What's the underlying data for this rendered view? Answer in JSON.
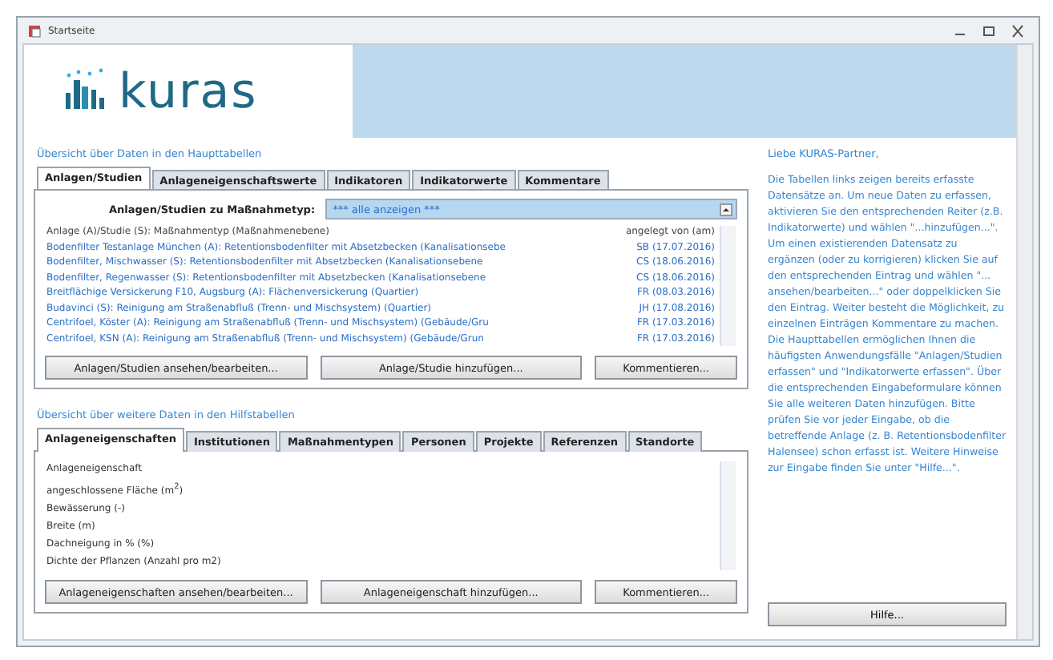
{
  "window": {
    "title": "Startseite"
  },
  "logo": {
    "text": "kuras"
  },
  "main": {
    "link": "Übersicht über Daten in den Haupttabellen",
    "tabs": [
      {
        "label": "Anlagen/Studien",
        "selected": true
      },
      {
        "label": "Anlageneigenschaftswerte",
        "selected": false
      },
      {
        "label": "Indikatoren",
        "selected": false
      },
      {
        "label": "Indikatorwerte",
        "selected": false
      },
      {
        "label": "Kommentare",
        "selected": false
      }
    ],
    "filter": {
      "label": "Anlagen/Studien zu Maßnahmetyp:",
      "value": "*** alle anzeigen ***"
    },
    "columns": [
      "Anlage (A)/Studie (S): Maßnahmentyp (Maßnahmenebene)",
      "angelegt von (am)"
    ],
    "rows": [
      [
        "Bodenfilter Testanlage München (A): Retentionsbodenfilter mit Absetzbecken (Kanalisationsebe",
        "SB (17.07.2016)"
      ],
      [
        "Bodenfilter, Mischwasser (S): Retentionsbodenfilter mit Absetzbecken (Kanalisationsebene",
        "CS (18.06.2016)"
      ],
      [
        "Bodenfilter, Regenwasser (S): Retentionsbodenfilter mit Absetzbecken (Kanalisationsebene",
        "CS (18.06.2016)"
      ],
      [
        "Breitflächige Versickerung F10, Augsburg (A): Flächenversickerung (Quartier)",
        "FR (08.03.2016)"
      ],
      [
        "Budavinci (S): Reinigung am Straßenabfluß (Trenn- und Mischsystem) (Quartier)",
        "JH (17.08.2016)"
      ],
      [
        "Centrifoel, Köster (A): Reinigung am Straßenabfluß (Trenn- und Mischsystem) (Gebäude/Gru",
        "FR (17.03.2016)"
      ],
      [
        "Centrifoel, KSN (A): Reinigung am Straßenabfluß (Trenn- und Mischsystem) (Gebäude/Grun",
        "FR (17.03.2016)"
      ]
    ],
    "buttons": [
      "Anlagen/Studien ansehen/bearbeiten...",
      "Anlage/Studie hinzufügen...",
      "Kommentieren..."
    ]
  },
  "aux": {
    "link": "Übersicht über weitere Daten in den Hilfstabellen",
    "tabs": [
      {
        "label": "Anlageneigenschaften",
        "selected": true
      },
      {
        "label": "Institutionen",
        "selected": false
      },
      {
        "label": "Maßnahmentypen",
        "selected": false
      },
      {
        "label": "Personen",
        "selected": false
      },
      {
        "label": "Projekte",
        "selected": false
      },
      {
        "label": "Referenzen",
        "selected": false
      },
      {
        "label": "Standorte",
        "selected": false
      }
    ],
    "column": "Anlageneigenschaft",
    "rows": [
      "angeschlossene Fläche (m$^{2}$)",
      "Bewässerung (-)",
      "Breite (m)",
      "Dachneigung in % (%)",
      "Dichte der Pflanzen (Anzahl pro m2)"
    ],
    "buttons": [
      "Anlageneigenschaften ansehen/bearbeiten...",
      "Anlageneigenschaft hinzufügen...",
      "Kommentieren..."
    ]
  },
  "info": {
    "greeting": "Liebe KURAS-Partner,",
    "text": "Die Tabellen links zeigen bereits erfasste Datensätze an. Um neue Daten zu erfassen, aktivieren Sie den entsprechenden Reiter (z.B. Indikatorwerte) und wählen \"...hinzufügen...\". Um einen existierenden Datensatz zu ergänzen (oder zu korrigieren) klicken Sie auf den entsprechenden Eintrag und wählen \"... ansehen/bearbeiten...\" oder doppelklicken Sie den Eintrag. Weiter besteht die Möglichkeit, zu einzelnen Einträgen Kommentare zu machen. Die Haupttabellen ermöglichen Ihnen die häufigsten Anwendungsfälle \"Anlagen/Studien erfassen\" und \"Indikatorwerte erfassen\". Über die entsprechenden Eingabeformulare können Sie alle weiteren Daten hinzufügen. Bitte prüfen Sie vor jeder Eingabe, ob die betreffende Anlage (z. B. Retentionsbodenfilter Halensee) schon erfasst ist. Weitere Hinweise zur Eingabe finden Sie unter \"Hilfe...\".",
    "button": "Hilfe..."
  }
}
